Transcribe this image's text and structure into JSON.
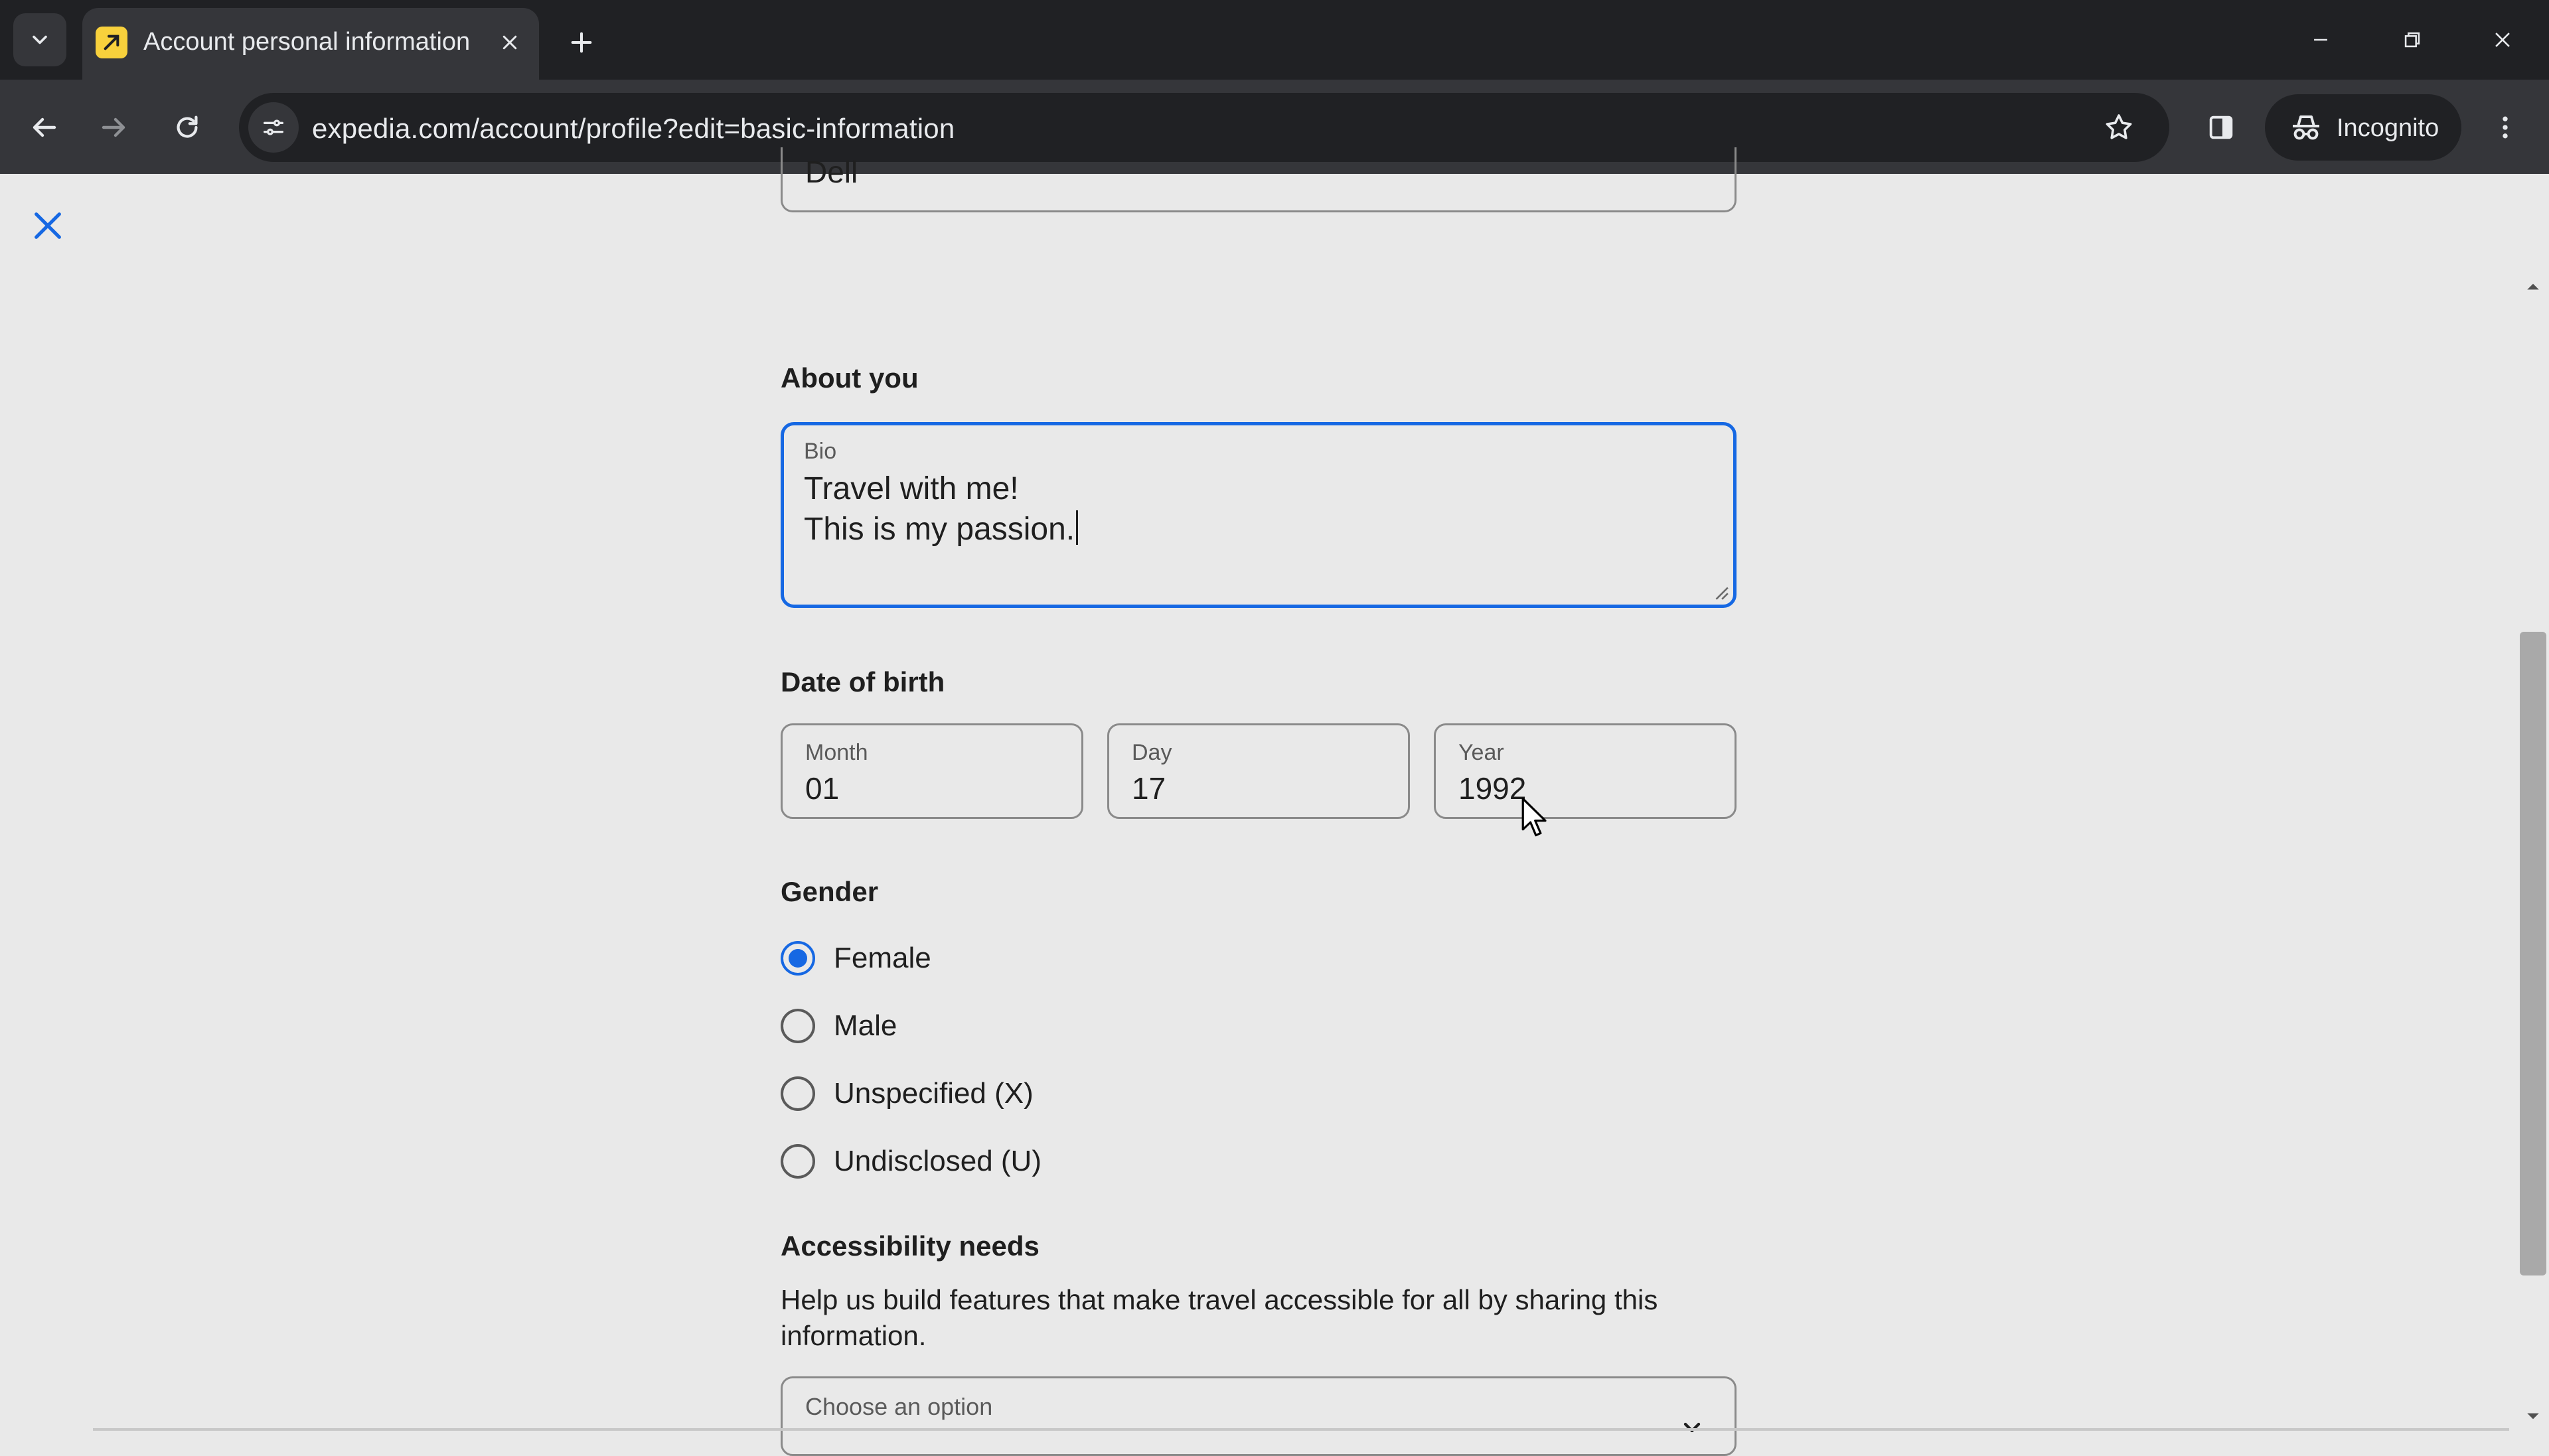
{
  "browser": {
    "tab_title": "Account personal information",
    "url": "expedia.com/account/profile?edit=basic-information",
    "incognito_label": "Incognito",
    "icons": {
      "tab_search": "chevron-down-icon",
      "favicon": "expedia-logo-icon",
      "tab_close": "close-icon",
      "new_tab": "plus-icon",
      "back": "arrow-left-icon",
      "forward": "arrow-right-icon",
      "reload": "reload-icon",
      "site_info": "tune-icon",
      "bookmark": "star-icon",
      "side_panel": "side-panel-icon",
      "menu": "kebab-menu-icon"
    }
  },
  "form": {
    "last_name_value": "Dell",
    "about": {
      "title": "About you",
      "bio_label": "Bio",
      "bio_line1": "Travel with me!",
      "bio_line2": "This is my passion."
    },
    "dob": {
      "title": "Date of birth",
      "month_label": "Month",
      "month_value": "01",
      "day_label": "Day",
      "day_value": "17",
      "year_label": "Year",
      "year_value": "1992"
    },
    "gender": {
      "title": "Gender",
      "options": [
        {
          "label": "Female",
          "checked": true
        },
        {
          "label": "Male",
          "checked": false
        },
        {
          "label": "Unspecified (X)",
          "checked": false
        },
        {
          "label": "Undisclosed (U)",
          "checked": false
        }
      ]
    },
    "accessibility": {
      "title": "Accessibility needs",
      "description": "Help us build features that make travel accessible for all by sharing this information.",
      "select_label": "Choose an option"
    }
  },
  "colors": {
    "accent": "#1668e3",
    "chrome_dark": "#202124",
    "chrome_mid": "#35363a",
    "page_bg": "#e9e9e9"
  }
}
